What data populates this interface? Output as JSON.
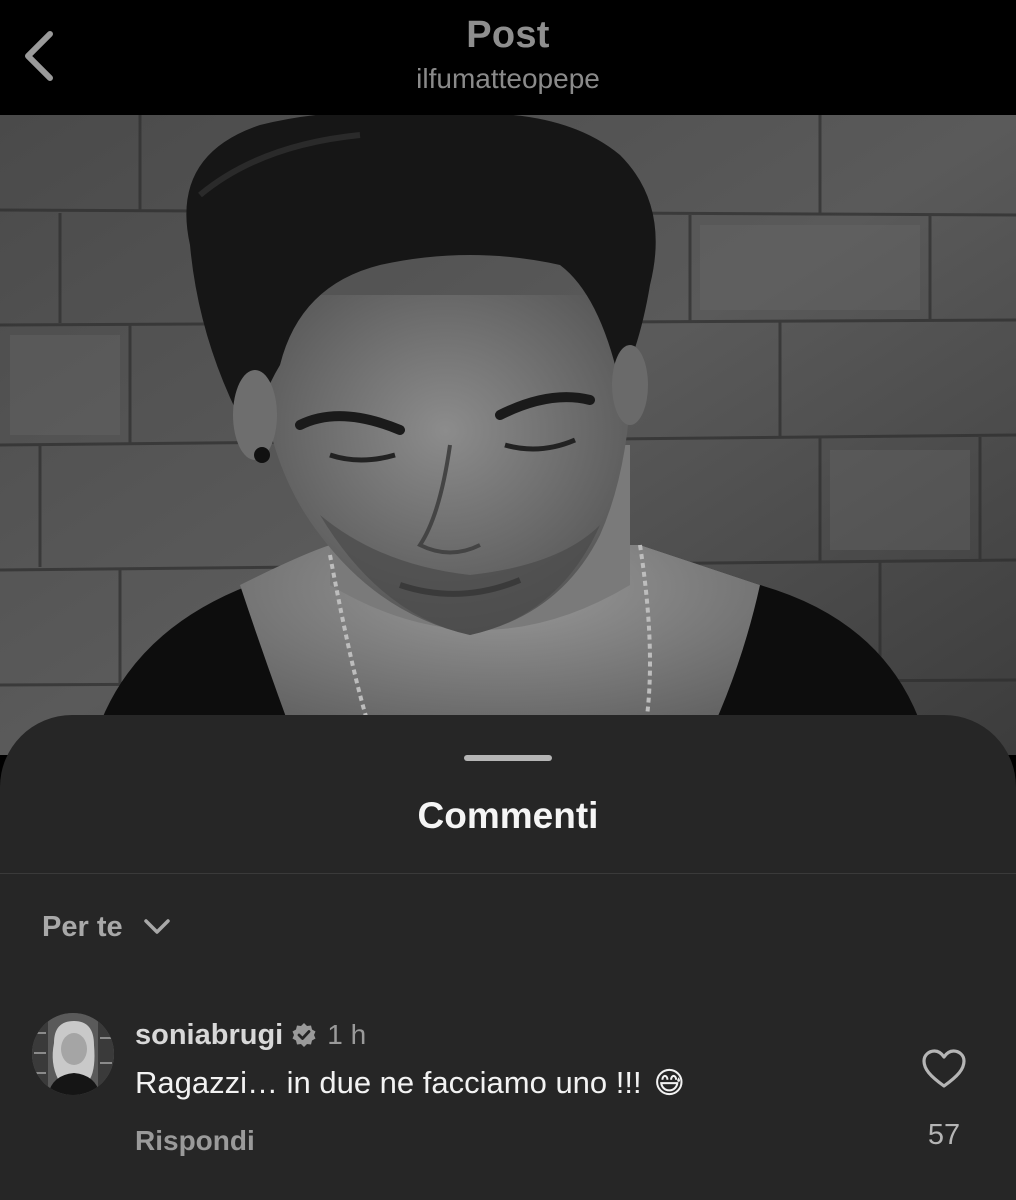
{
  "header": {
    "title": "Post",
    "subtitle": "ilfumatteopepe",
    "back_icon": "chevron-left-icon"
  },
  "post": {
    "image_description_icon": "photo-grayscale"
  },
  "comments_sheet": {
    "title": "Commenti",
    "sort_label": "Per te",
    "sort_icon": "chevron-down-icon"
  },
  "comments": [
    {
      "username": "soniabrugi",
      "verified": true,
      "time": "1 h",
      "text": "Ragazzi… in due ne facciamo uno !!!",
      "emoji": "😅",
      "reply_label": "Rispondi",
      "like_count": "57",
      "like_icon": "heart-outline-icon"
    }
  ],
  "colors": {
    "background": "#000000",
    "sheet": "#262626",
    "primary_text": "#f2f2f2",
    "secondary_text": "#9a9a9a"
  }
}
